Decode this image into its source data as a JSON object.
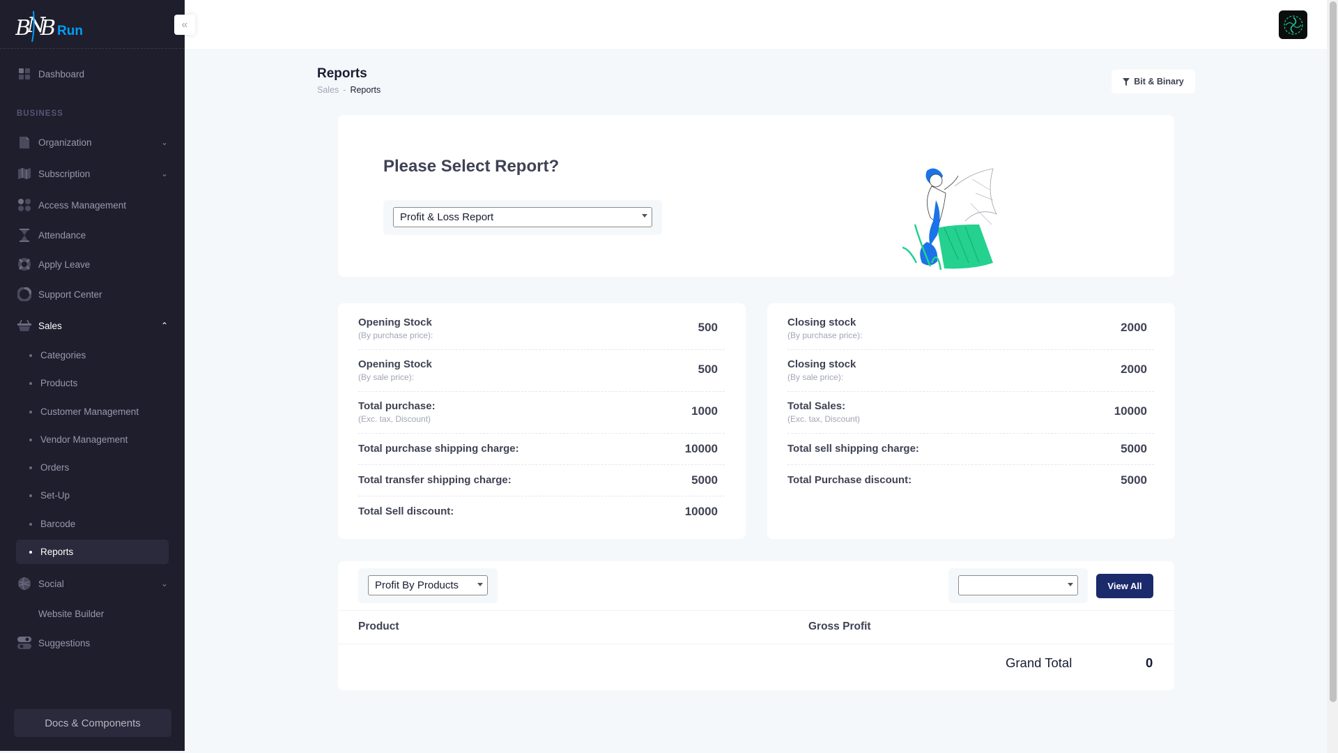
{
  "brand": {
    "logo_letters": "BNB",
    "logo_suffix": "Run",
    "accent": "#009ef7"
  },
  "sidebar": {
    "section_label": "BUSINESS",
    "items": [
      {
        "label": "Dashboard",
        "icon": "dashboard-icon"
      },
      {
        "label": "Organization",
        "icon": "document-icon",
        "chevron": "down"
      },
      {
        "label": "Subscription",
        "icon": "map-icon",
        "chevron": "down"
      },
      {
        "label": "Access Management",
        "icon": "users-icon"
      },
      {
        "label": "Attendance",
        "icon": "hourglass-icon"
      },
      {
        "label": "Apply Leave",
        "icon": "lifebuoy-icon"
      },
      {
        "label": "Support Center",
        "icon": "chart-pie-icon"
      },
      {
        "label": "Sales",
        "icon": "basket-icon",
        "chevron": "up",
        "expanded": true
      },
      {
        "label": "Social",
        "icon": "globe-icon",
        "chevron": "down"
      },
      {
        "label": "Website Builder"
      },
      {
        "label": "Suggestions",
        "icon": "toggle-icon"
      }
    ],
    "sales_sub_items": [
      {
        "label": "Categories"
      },
      {
        "label": "Products"
      },
      {
        "label": "Customer Management"
      },
      {
        "label": "Vendor Management"
      },
      {
        "label": "Orders"
      },
      {
        "label": "Set-Up"
      },
      {
        "label": "Barcode"
      },
      {
        "label": "Reports",
        "active": true
      }
    ],
    "docs_button": "Docs & Components"
  },
  "page": {
    "title": "Reports",
    "breadcrumb": [
      "Sales",
      "-",
      "Reports"
    ],
    "filter_button": "Bit & Binary"
  },
  "report_select": {
    "title": "Please Select Report?",
    "selected": "Profit & Loss Report"
  },
  "stats_left": [
    {
      "title": "Opening Stock",
      "sub": "(By purchase price):",
      "value": "500"
    },
    {
      "title": "Opening Stock",
      "sub": "(By sale price):",
      "value": "500"
    },
    {
      "title": "Total purchase:",
      "sub": "(Exc. tax, Discount)",
      "value": "1000"
    },
    {
      "title": "Total purchase shipping charge:",
      "value": "10000"
    },
    {
      "title": "Total transfer shipping charge:",
      "value": "5000"
    },
    {
      "title": "Total Sell discount:",
      "value": "10000"
    }
  ],
  "stats_right": [
    {
      "title": "Closing stock",
      "sub": "(By purchase price):",
      "value": "2000"
    },
    {
      "title": "Closing stock",
      "sub": "(By sale price):",
      "value": "2000"
    },
    {
      "title": "Total Sales:",
      "sub": "(Exc. tax, Discount)",
      "value": "10000"
    },
    {
      "title": "Total sell shipping charge:",
      "value": "5000"
    },
    {
      "title": "Total Purchase discount:",
      "value": "5000"
    }
  ],
  "profit_table": {
    "group_by": "Profit By Products",
    "secondary_select": "",
    "view_all": "View All",
    "columns": [
      "Product",
      "Gross Profit"
    ],
    "grand_total_label": "Grand Total",
    "grand_total_value": "0"
  }
}
